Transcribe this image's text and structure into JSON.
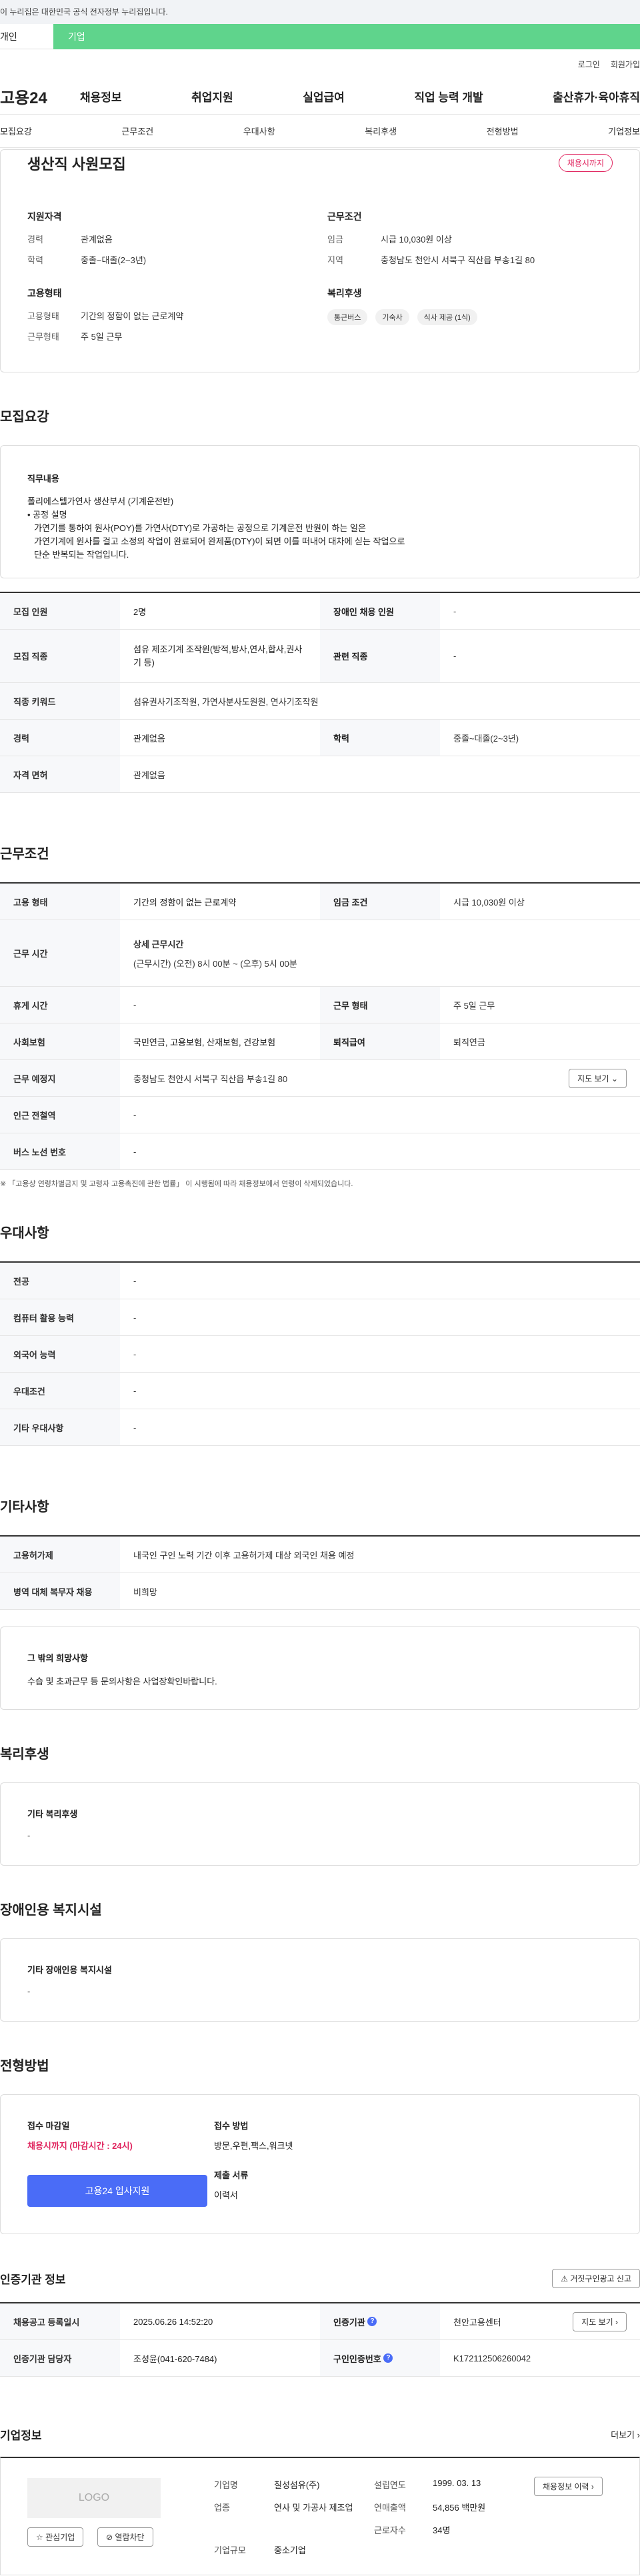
{
  "gov_banner": "이 누리집은 대한민국 공식 전자정부 누리집입니다.",
  "tabs": {
    "individual": "개인",
    "company": "기업"
  },
  "util_links": [
    "로그인",
    "회원가입"
  ],
  "gnb": {
    "logo": "고용24",
    "menu": [
      "채용정보",
      "취업지원",
      "실업급여",
      "직업 능력 개발",
      "출산휴가·육아휴직"
    ]
  },
  "subnav": [
    "모집요강",
    "근무조건",
    "우대사항",
    "복리후생",
    "전형방법",
    "기업정보"
  ],
  "summary": {
    "title": "생산직 사원모집",
    "badge": "채용시까지",
    "qualification": {
      "heading": "지원자격",
      "career_label": "경력",
      "career": "관계없음",
      "edu_label": "학력",
      "edu": "중졸~대졸(2~3년)"
    },
    "condition": {
      "heading": "근무조건",
      "wage_label": "임금",
      "wage": "시급 10,030원 이상",
      "region_label": "지역",
      "region": "충청남도 천안시 서북구 직산읍 부송1길 80"
    },
    "employment": {
      "heading": "고용형태",
      "type_label": "고용형태",
      "type": "기간의 정함이 없는 근로계약",
      "work_label": "근무형태",
      "work": "주 5일 근무"
    },
    "welfare": {
      "heading": "복리후생",
      "chips": [
        "통근버스",
        "기숙사",
        "식사 제공 (1식)"
      ]
    }
  },
  "recruit": {
    "title": "모집요강",
    "duty_heading": "직무내용",
    "duty_lines": [
      "폴리에스텔가연사 생산부서 (기계운전반)",
      "• 공정 설명",
      "  가연기를 통하여 원사(POY)를 가연사(DTY)로 가공하는 공정으로 기계운전 반원이 하는 일은",
      "  가연기계에 원사를 걸고 소정의 작업이 완료되어 완제품(DTY)이 되면 이를 떠내어 대차에 싣는 작업으로",
      "  단순 반복되는 작업입니다."
    ],
    "rows": [
      {
        "k": "모집 인원",
        "v": "2명",
        "k2": "장애인 채용 인원",
        "v2": "-"
      },
      {
        "k": "모집 직종",
        "v": "섬유 제조기계 조작원(방적,방사,연사,합사,권사기 등)",
        "k2": "관련 직종",
        "v2": "-"
      },
      {
        "k": "직종 키워드",
        "v": "섬유권사기조작원, 가연사분사도원원, 연사기조작원"
      },
      {
        "k": "경력",
        "v": "관계없음",
        "k2": "학력",
        "v2": "중졸~대졸(2~3년)"
      },
      {
        "k": "자격 면허",
        "v": "관계없음"
      }
    ]
  },
  "work": {
    "title": "근무조건",
    "rows": [
      {
        "k": "고용 형태",
        "v": "기간의 정함이 없는 근로계약",
        "k2": "임금 조건",
        "v2": "시급 10,030원 이상"
      },
      {
        "k": "근무 시간",
        "v_title": "상세 근무시간",
        "v": "(근무시간) (오전) 8시 00분 ~ (오후) 5시 00분"
      },
      {
        "k": "휴게 시간",
        "v": "-",
        "k2": "근무 형태",
        "v2": "주 5일 근무"
      },
      {
        "k": "사회보험",
        "v": "국민연금, 고용보험, 산재보험, 건강보험",
        "k2": "퇴직급여",
        "v2": "퇴직연금"
      },
      {
        "k": "근무 예정지",
        "v": "충청남도 천안시 서북구 직산읍 부송1길 80",
        "btn": "지도 보기"
      },
      {
        "k": "인근 전철역",
        "v": "-"
      },
      {
        "k": "버스 노선 번호",
        "v": "-"
      }
    ],
    "note": "※ 「고용상 연령차별금지 및 고령자 고용촉진에 관한 법률」 이 시행됨에 따라 채용정보에서 연령이 삭제되었습니다."
  },
  "prefer": {
    "title": "우대사항",
    "rows": [
      {
        "k": "전공",
        "v": "-"
      },
      {
        "k": "컴퓨터 활용 능력",
        "v": "-"
      },
      {
        "k": "외국어 능력",
        "v": "-"
      },
      {
        "k": "우대조건",
        "v": "-"
      },
      {
        "k": "기타 우대사항",
        "v": "-"
      }
    ]
  },
  "etc": {
    "title": "기타사항",
    "rows": [
      {
        "k": "고용허가제",
        "v": "내국인 구인 노력 기간 이후 고용허가제 대상 외국인 채용 예정"
      },
      {
        "k": "병역 대체 복무자 채용",
        "v": "비희망"
      }
    ],
    "extra_heading": "그 밖의 희망사항",
    "extra": "수습 및 초과근무 등 문의사항은 사업장확인바랍니다."
  },
  "welfare": {
    "title": "복리후생",
    "heading": "기타 복리후생",
    "value": "-"
  },
  "disabled": {
    "title": "장애인용 복지시설",
    "heading": "기타 장애인용 복지시설",
    "value": "-"
  },
  "screening": {
    "title": "전형방법",
    "deadline_label": "접수 마감일",
    "deadline": "채용시까지 (마감시간 : 24시)",
    "apply_btn": "고용24 입사지원",
    "method_label": "접수 방법",
    "method": "방문,우편,팩스,워크넷",
    "docs_label": "제출 서류",
    "docs": "이력서"
  },
  "agency": {
    "title": "인증기관 정보",
    "report_btn": "거짓구인광고 신고",
    "reg_label": "채용공고 등록일시",
    "reg": "2025.06.26 14:52:20",
    "cert_label": "인증기관",
    "cert": "천안고용센터",
    "map_btn": "지도 보기",
    "manager_label": "인증기관 담당자",
    "manager": "조성윤(041-620-7484)",
    "no_label": "구인인증번호",
    "no": "K172112506260042"
  },
  "company": {
    "title": "기업정보",
    "more": "더보기",
    "logo_text": "LOGO",
    "fav_btn": "관심기업",
    "block_btn": "열람차단",
    "name_label": "기업명",
    "name": "칠성섬유(주)",
    "industry_label": "업종",
    "industry": "연사 및 가공사 제조업",
    "size_label": "기업규모",
    "size": "중소기업",
    "founded_label": "설립연도",
    "founded": "1999. 03. 13",
    "revenue_label": "연매출액",
    "revenue": "54,856 백만원",
    "workers_label": "근로자수",
    "workers": "34명",
    "jobs_btn": "채용정보 이력"
  },
  "colors": {
    "brand_green": "#5fd48c",
    "accent_red": "#e0245e",
    "apply_blue": "#4a6cf7"
  }
}
